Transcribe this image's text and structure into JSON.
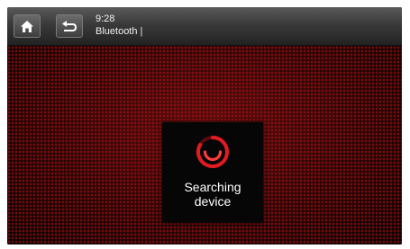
{
  "colors": {
    "accent": "#e01b22",
    "background": "#1c0506",
    "topbar": "#3a3a3a",
    "dialog": "#060606",
    "text": "#ffffff"
  },
  "topbar": {
    "home_icon": "home-icon",
    "back_icon": "back-arrow-icon",
    "time": "9:28",
    "title": "Bluetooth"
  },
  "dialog": {
    "icon": "spinner-icon",
    "message_line1": "Searching",
    "message_line2": "device"
  }
}
